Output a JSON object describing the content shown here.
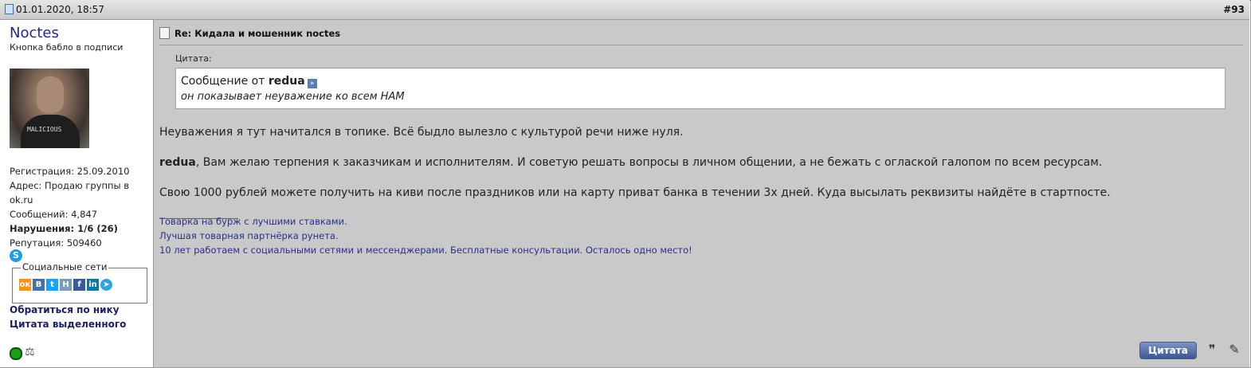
{
  "post": {
    "date": "01.01.2020, 18:57",
    "number": "#93",
    "title": "Re: Кидала и мошенник noctes",
    "quote_label": "Цитата:",
    "quote_prefix": "Сообщение от",
    "quote_author": "redua",
    "quote_text": "он показывает неуважение ко всем НАМ",
    "para1": "Неуважения я тут начитался в топике. Всё быдло вылезло с культурой речи ниже нуля.",
    "para2_name": "redua",
    "para2_rest": ", Вам желаю терпения к заказчикам и исполнителям. И советую решать вопросы в личном общении, а не бежать с оглаской галопом по всем ресурсам.",
    "para3": "Свою 1000 рублей можете получить на киви после праздников или на карту приват банка в течении 3х дней. Куда высылать реквизиты найдёте в стартпосте.",
    "signature_sep": "__________________",
    "signature": [
      "Товарка на бурж с лучшими ставками.",
      "Лучшая товарная партнёрка рунета.",
      "10 лет работаем с социальными сетями и мессенджерами. Бесплатные консультации. Осталось одно место!"
    ],
    "quote_button": "Цитата"
  },
  "user": {
    "name": "Noctes",
    "title": "Кнопка бабло в подписи",
    "avatar_text": "MALICIOUS",
    "reg_label": "Регистрация:",
    "reg_value": "25.09.2010",
    "addr_label": "Адрес:",
    "addr_value": "Продаю группы в ok.ru",
    "msgs_label": "Сообщений:",
    "msgs_value": "4,847",
    "viol_label": "Нарушения:",
    "viol_value": "1/6 (26)",
    "rep_label": "Репутация:",
    "rep_value": "509460",
    "social_legend": "Социальные сети",
    "link_mention": "Обратиться по нику",
    "link_quote": "Цитата выделенного"
  },
  "icons": [
    "document-icon",
    "skype-icon",
    "odnoklassniki-icon",
    "vkontakte-icon",
    "twitter-icon",
    "habr-icon",
    "facebook-icon",
    "linkedin-icon",
    "telegram-icon",
    "online-status-icon",
    "user-scales-icon",
    "multiquote-icon",
    "quick-reply-icon"
  ],
  "colors": {
    "content_bg": "#c9c9c9",
    "username": "#23278a",
    "signature": "#2a2f86",
    "online": "#19a019"
  }
}
